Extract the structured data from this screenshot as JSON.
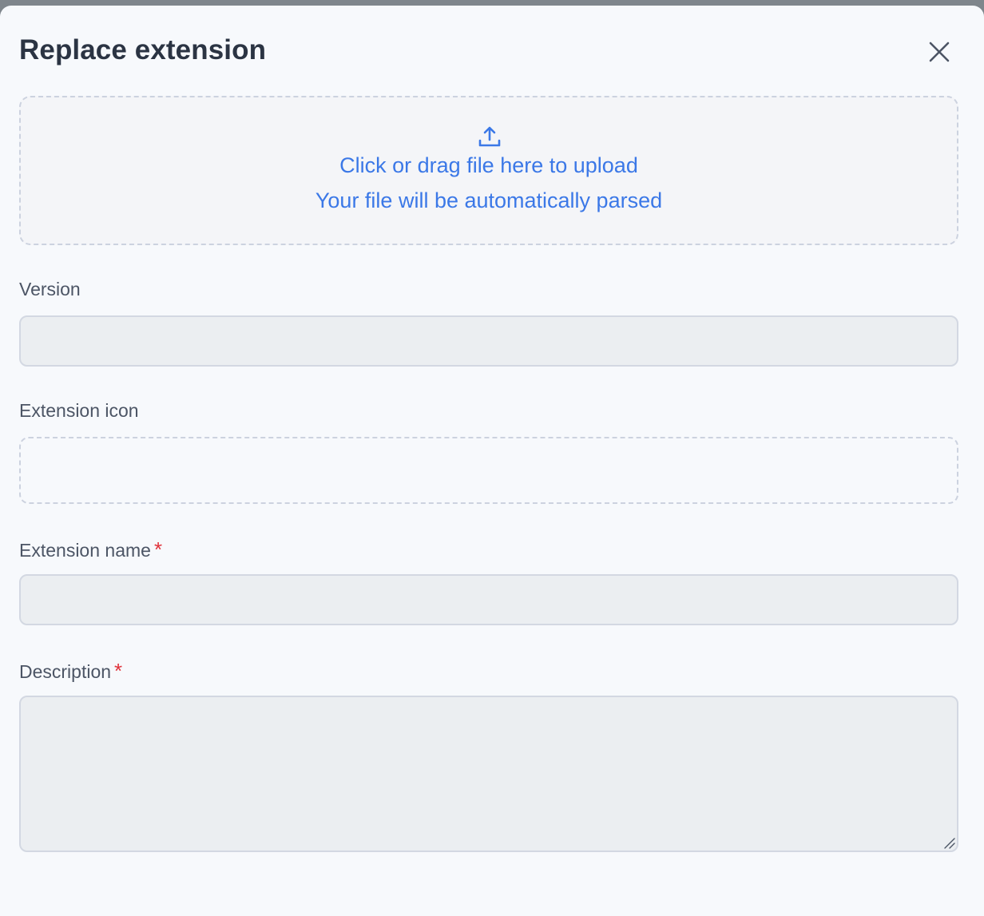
{
  "dialog": {
    "title": "Replace extension"
  },
  "upload": {
    "line1": "Click or drag file here to upload",
    "line2": "Your file will be automatically parsed"
  },
  "fields": {
    "version": {
      "label": "Version",
      "value": ""
    },
    "icon": {
      "label": "Extension icon"
    },
    "name": {
      "label": "Extension name",
      "required_mark": "*",
      "value": ""
    },
    "description": {
      "label": "Description",
      "required_mark": "*",
      "value": ""
    }
  },
  "colors": {
    "accent": "#3b78e7",
    "required": "#e0323a",
    "title": "#2b3443"
  },
  "icons": {
    "close": "close-icon",
    "upload": "upload-icon",
    "resize": "resize-grip-icon"
  }
}
